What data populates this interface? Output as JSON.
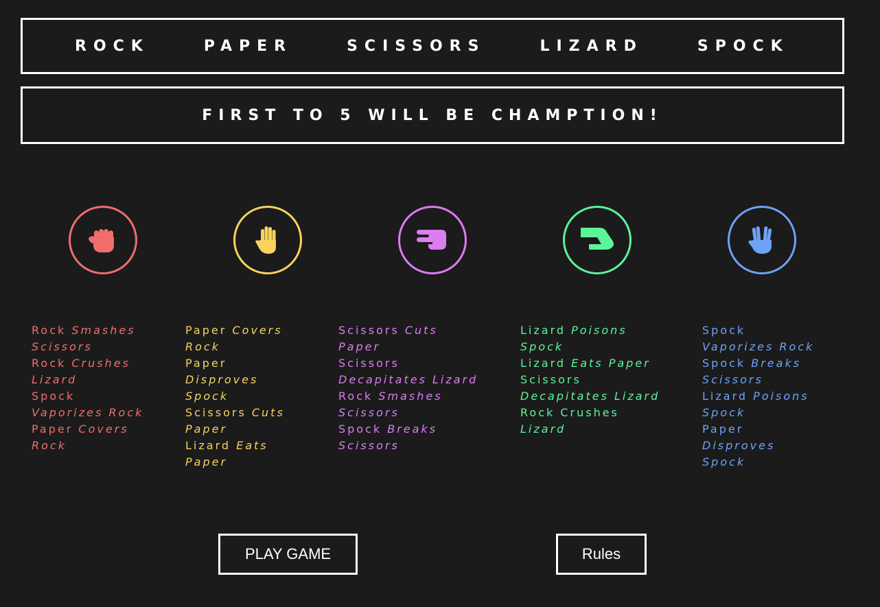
{
  "title": {
    "words": [
      "ROCK",
      "PAPER",
      "SCISSORS",
      "LIZARD",
      "SPOCK"
    ]
  },
  "subtitle": "FIRST TO 5 WILL BE CHAMPTION!",
  "choices": [
    {
      "name": "rock",
      "icon": "fist-icon",
      "color": "#f26d6d"
    },
    {
      "name": "paper",
      "icon": "open-hand-icon",
      "color": "#f9d35c"
    },
    {
      "name": "scissors",
      "icon": "scissors-hand-icon",
      "color": "#dc7df0"
    },
    {
      "name": "lizard",
      "icon": "lizard-hand-icon",
      "color": "#5cf59a"
    },
    {
      "name": "spock",
      "icon": "vulcan-salute-icon",
      "color": "#6ea3f5"
    }
  ],
  "rules": [
    {
      "color": "#f26d6d",
      "lines": [
        {
          "normal": "Rock ",
          "italic": "Smashes"
        },
        {
          "normal": "",
          "italic": "Scissors"
        },
        {
          "normal": "Rock ",
          "italic": "Crushes"
        },
        {
          "normal": "",
          "italic": "Lizard"
        },
        {
          "normal": "Spock",
          "italic": ""
        },
        {
          "normal": "",
          "italic": "Vaporizes Rock"
        },
        {
          "normal": "Paper ",
          "italic": "Covers"
        },
        {
          "normal": "",
          "italic": "Rock"
        }
      ]
    },
    {
      "color": "#f9d35c",
      "lines": [
        {
          "normal": "Paper ",
          "italic": "Covers"
        },
        {
          "normal": "",
          "italic": "Rock"
        },
        {
          "normal": "Paper",
          "italic": ""
        },
        {
          "normal": "",
          "italic": "Disproves"
        },
        {
          "normal": "",
          "italic": "Spock"
        },
        {
          "normal": "Scissors ",
          "italic": "Cuts"
        },
        {
          "normal": "",
          "italic": "Paper"
        },
        {
          "normal": "Lizard ",
          "italic": "Eats"
        },
        {
          "normal": "",
          "italic": "Paper"
        }
      ]
    },
    {
      "color": "#dc7df0",
      "lines": [
        {
          "normal": "Scissors ",
          "italic": "Cuts"
        },
        {
          "normal": "",
          "italic": "Paper"
        },
        {
          "normal": "Scissors",
          "italic": ""
        },
        {
          "normal": "",
          "italic": "Decapitates Lizard"
        },
        {
          "normal": "Rock ",
          "italic": "Smashes"
        },
        {
          "normal": "",
          "italic": "Scissors"
        },
        {
          "normal": "Spock ",
          "italic": "Breaks"
        },
        {
          "normal": "",
          "italic": "Scissors"
        }
      ]
    },
    {
      "color": "#5cf59a",
      "lines": [
        {
          "normal": "Lizard ",
          "italic": "Poisons"
        },
        {
          "normal": "",
          "italic": "Spock"
        },
        {
          "normal": "Lizard ",
          "italic": "Eats Paper"
        },
        {
          "normal": "Scissors",
          "italic": ""
        },
        {
          "normal": "",
          "italic": "Decapitates Lizard"
        },
        {
          "normal": "Rock Crushes",
          "italic": ""
        },
        {
          "normal": "",
          "italic": "Lizard"
        }
      ]
    },
    {
      "color": "#6ea3f5",
      "lines": [
        {
          "normal": "Spock",
          "italic": ""
        },
        {
          "normal": "",
          "italic": "Vaporizes Rock"
        },
        {
          "normal": "Spock ",
          "italic": "Breaks"
        },
        {
          "normal": "",
          "italic": "Scissors"
        },
        {
          "normal": "Lizard ",
          "italic": "Poisons"
        },
        {
          "normal": "",
          "italic": "Spock"
        },
        {
          "normal": "Paper",
          "italic": ""
        },
        {
          "normal": "",
          "italic": "Disproves"
        },
        {
          "normal": "",
          "italic": "Spock"
        }
      ]
    }
  ],
  "buttons": {
    "play": "PLAY GAME",
    "rules": "Rules"
  }
}
